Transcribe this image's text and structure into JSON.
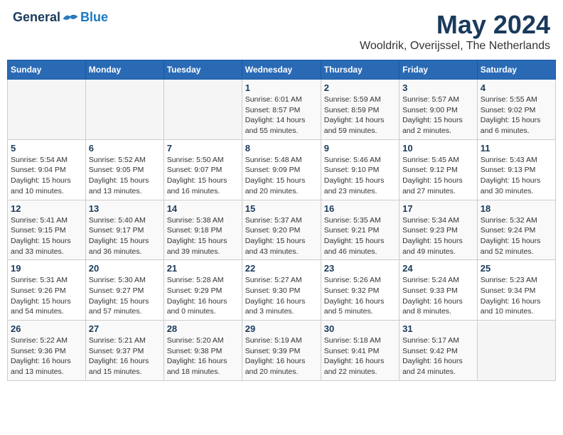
{
  "header": {
    "logo_general": "General",
    "logo_blue": "Blue",
    "month": "May 2024",
    "location": "Wooldrik, Overijssel, The Netherlands"
  },
  "days_of_week": [
    "Sunday",
    "Monday",
    "Tuesday",
    "Wednesday",
    "Thursday",
    "Friday",
    "Saturday"
  ],
  "weeks": [
    [
      {
        "day": "",
        "info": ""
      },
      {
        "day": "",
        "info": ""
      },
      {
        "day": "",
        "info": ""
      },
      {
        "day": "1",
        "info": "Sunrise: 6:01 AM\nSunset: 8:57 PM\nDaylight: 14 hours\nand 55 minutes."
      },
      {
        "day": "2",
        "info": "Sunrise: 5:59 AM\nSunset: 8:59 PM\nDaylight: 14 hours\nand 59 minutes."
      },
      {
        "day": "3",
        "info": "Sunrise: 5:57 AM\nSunset: 9:00 PM\nDaylight: 15 hours\nand 2 minutes."
      },
      {
        "day": "4",
        "info": "Sunrise: 5:55 AM\nSunset: 9:02 PM\nDaylight: 15 hours\nand 6 minutes."
      }
    ],
    [
      {
        "day": "5",
        "info": "Sunrise: 5:54 AM\nSunset: 9:04 PM\nDaylight: 15 hours\nand 10 minutes."
      },
      {
        "day": "6",
        "info": "Sunrise: 5:52 AM\nSunset: 9:05 PM\nDaylight: 15 hours\nand 13 minutes."
      },
      {
        "day": "7",
        "info": "Sunrise: 5:50 AM\nSunset: 9:07 PM\nDaylight: 15 hours\nand 16 minutes."
      },
      {
        "day": "8",
        "info": "Sunrise: 5:48 AM\nSunset: 9:09 PM\nDaylight: 15 hours\nand 20 minutes."
      },
      {
        "day": "9",
        "info": "Sunrise: 5:46 AM\nSunset: 9:10 PM\nDaylight: 15 hours\nand 23 minutes."
      },
      {
        "day": "10",
        "info": "Sunrise: 5:45 AM\nSunset: 9:12 PM\nDaylight: 15 hours\nand 27 minutes."
      },
      {
        "day": "11",
        "info": "Sunrise: 5:43 AM\nSunset: 9:13 PM\nDaylight: 15 hours\nand 30 minutes."
      }
    ],
    [
      {
        "day": "12",
        "info": "Sunrise: 5:41 AM\nSunset: 9:15 PM\nDaylight: 15 hours\nand 33 minutes."
      },
      {
        "day": "13",
        "info": "Sunrise: 5:40 AM\nSunset: 9:17 PM\nDaylight: 15 hours\nand 36 minutes."
      },
      {
        "day": "14",
        "info": "Sunrise: 5:38 AM\nSunset: 9:18 PM\nDaylight: 15 hours\nand 39 minutes."
      },
      {
        "day": "15",
        "info": "Sunrise: 5:37 AM\nSunset: 9:20 PM\nDaylight: 15 hours\nand 43 minutes."
      },
      {
        "day": "16",
        "info": "Sunrise: 5:35 AM\nSunset: 9:21 PM\nDaylight: 15 hours\nand 46 minutes."
      },
      {
        "day": "17",
        "info": "Sunrise: 5:34 AM\nSunset: 9:23 PM\nDaylight: 15 hours\nand 49 minutes."
      },
      {
        "day": "18",
        "info": "Sunrise: 5:32 AM\nSunset: 9:24 PM\nDaylight: 15 hours\nand 52 minutes."
      }
    ],
    [
      {
        "day": "19",
        "info": "Sunrise: 5:31 AM\nSunset: 9:26 PM\nDaylight: 15 hours\nand 54 minutes."
      },
      {
        "day": "20",
        "info": "Sunrise: 5:30 AM\nSunset: 9:27 PM\nDaylight: 15 hours\nand 57 minutes."
      },
      {
        "day": "21",
        "info": "Sunrise: 5:28 AM\nSunset: 9:29 PM\nDaylight: 16 hours\nand 0 minutes."
      },
      {
        "day": "22",
        "info": "Sunrise: 5:27 AM\nSunset: 9:30 PM\nDaylight: 16 hours\nand 3 minutes."
      },
      {
        "day": "23",
        "info": "Sunrise: 5:26 AM\nSunset: 9:32 PM\nDaylight: 16 hours\nand 5 minutes."
      },
      {
        "day": "24",
        "info": "Sunrise: 5:24 AM\nSunset: 9:33 PM\nDaylight: 16 hours\nand 8 minutes."
      },
      {
        "day": "25",
        "info": "Sunrise: 5:23 AM\nSunset: 9:34 PM\nDaylight: 16 hours\nand 10 minutes."
      }
    ],
    [
      {
        "day": "26",
        "info": "Sunrise: 5:22 AM\nSunset: 9:36 PM\nDaylight: 16 hours\nand 13 minutes."
      },
      {
        "day": "27",
        "info": "Sunrise: 5:21 AM\nSunset: 9:37 PM\nDaylight: 16 hours\nand 15 minutes."
      },
      {
        "day": "28",
        "info": "Sunrise: 5:20 AM\nSunset: 9:38 PM\nDaylight: 16 hours\nand 18 minutes."
      },
      {
        "day": "29",
        "info": "Sunrise: 5:19 AM\nSunset: 9:39 PM\nDaylight: 16 hours\nand 20 minutes."
      },
      {
        "day": "30",
        "info": "Sunrise: 5:18 AM\nSunset: 9:41 PM\nDaylight: 16 hours\nand 22 minutes."
      },
      {
        "day": "31",
        "info": "Sunrise: 5:17 AM\nSunset: 9:42 PM\nDaylight: 16 hours\nand 24 minutes."
      },
      {
        "day": "",
        "info": ""
      }
    ]
  ]
}
